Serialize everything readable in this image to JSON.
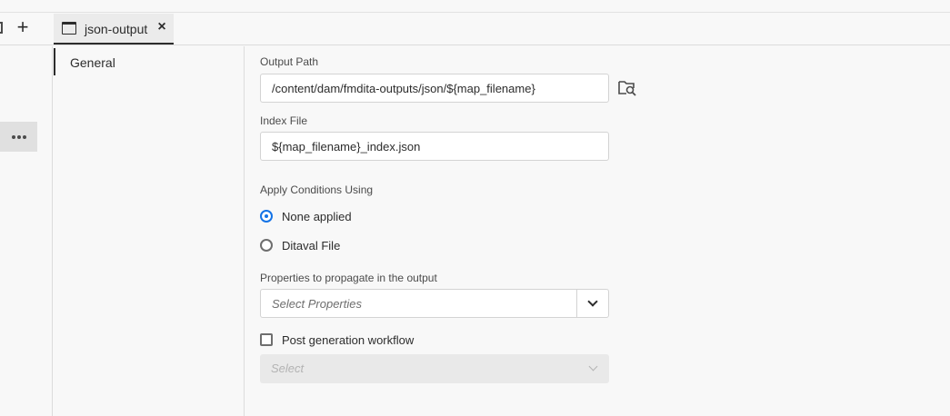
{
  "tabbar": {
    "new_tab_icon": "plus-icon",
    "tab": {
      "label": "json-output",
      "icon": "window-icon",
      "close_icon": "close-icon"
    }
  },
  "leftrail": {
    "more_icon": "more-icon"
  },
  "sidenav": {
    "items": [
      {
        "label": "General"
      }
    ]
  },
  "form": {
    "output_path": {
      "label": "Output Path",
      "value": "/content/dam/fmdita-outputs/json/${map_filename}",
      "browse_icon": "folder-search-icon"
    },
    "index_file": {
      "label": "Index File",
      "value": "${map_filename}_index.json"
    },
    "conditions": {
      "label": "Apply Conditions Using",
      "options": [
        {
          "label": "None applied",
          "selected": true
        },
        {
          "label": "Ditaval File",
          "selected": false
        }
      ]
    },
    "properties": {
      "label": "Properties to propagate in the output",
      "placeholder": "Select Properties",
      "dropdown_icon": "chevron-down-icon"
    },
    "post_generation": {
      "label": "Post generation workflow",
      "checked": false,
      "select_placeholder": "Select"
    }
  },
  "colors": {
    "accent": "#1473e6",
    "background": "#f8f8f8"
  }
}
